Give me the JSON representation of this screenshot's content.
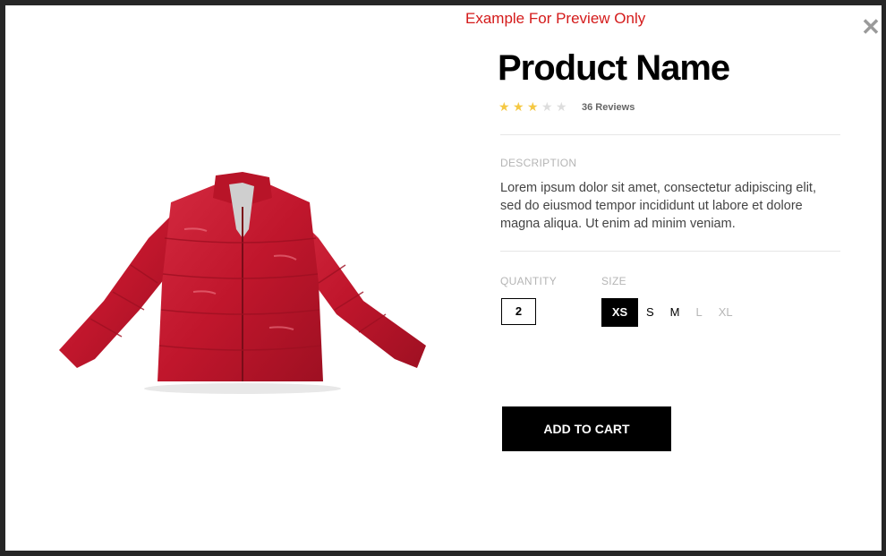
{
  "watermark": "Example For Preview Only",
  "product": {
    "name": "Product Name",
    "rating": 3,
    "rating_max": 5,
    "reviews": "36 Reviews",
    "description_label": "DESCRIPTION",
    "description": "Lorem ipsum dolor sit amet, consectetur adipiscing elit, sed do eiusmod tempor incididunt ut labore et dolore magna aliqua. Ut enim ad minim veniam.",
    "quantity_label": "QUANTITY",
    "quantity": "2",
    "size_label": "SIZE",
    "sizes": [
      {
        "label": "XS",
        "state": "selected"
      },
      {
        "label": "S",
        "state": "available"
      },
      {
        "label": "M",
        "state": "available"
      },
      {
        "label": "L",
        "state": "disabled"
      },
      {
        "label": "XL",
        "state": "disabled"
      }
    ],
    "add_to_cart": "ADD TO CART"
  },
  "colors": {
    "star_filled": "#f5c842",
    "star_empty": "#dddddd",
    "jacket": "#c8182e",
    "watermark": "#d41a1a"
  },
  "icons": {
    "close": "close-icon",
    "star": "star-icon"
  }
}
